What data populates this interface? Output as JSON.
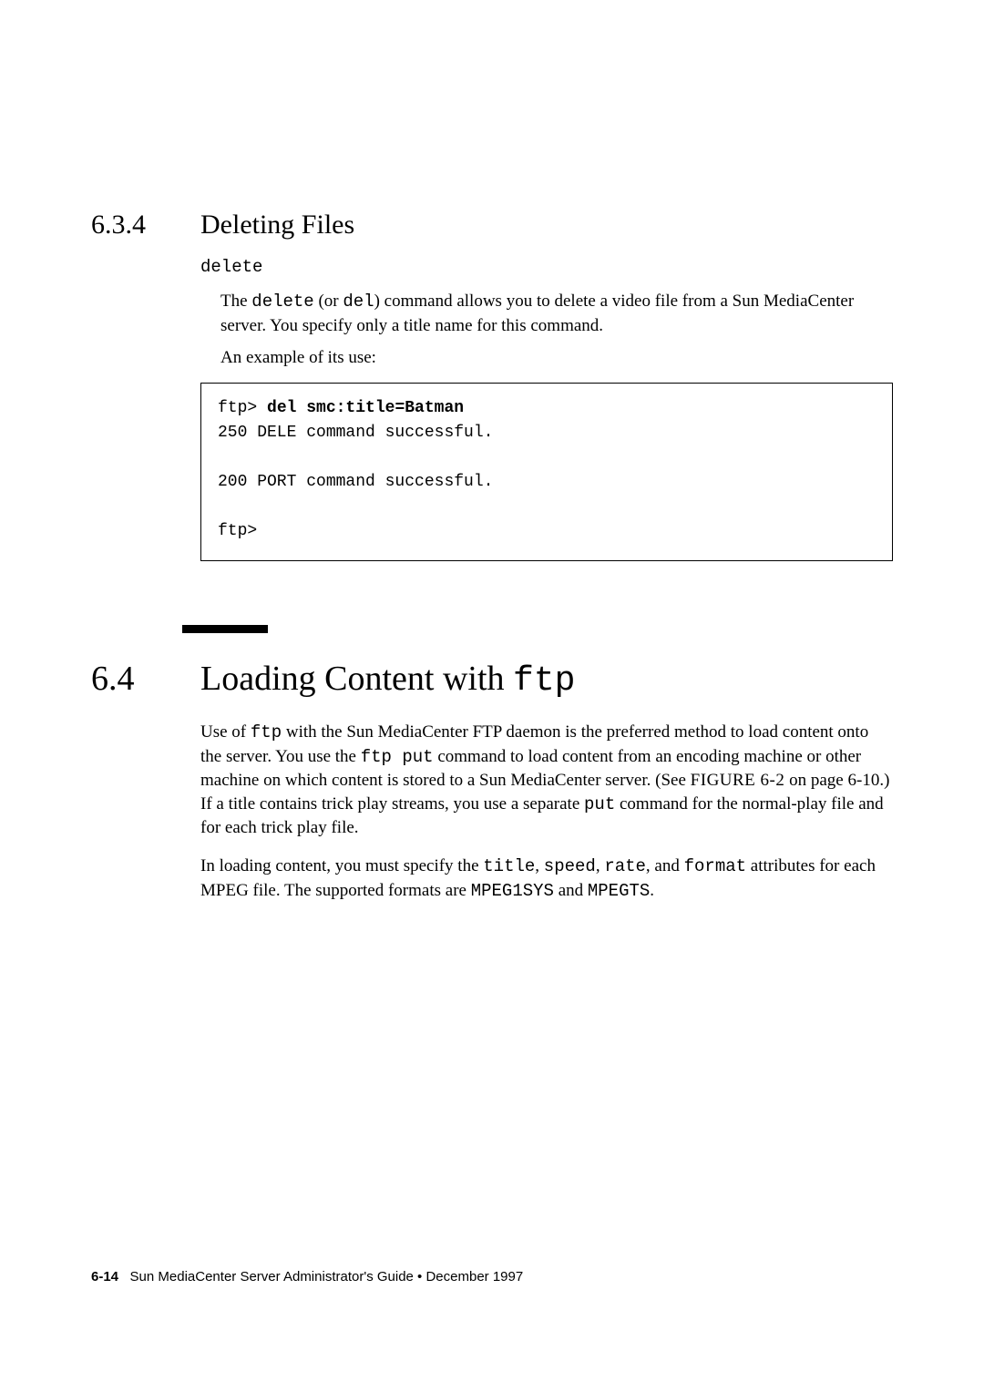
{
  "section_634": {
    "number": "6.3.4",
    "title": "Deleting Files",
    "delete_label": "delete",
    "para1_parts": {
      "a": "The ",
      "b": "delete",
      "c": " (or ",
      "d": "del",
      "e": ") command allows you to delete a video file from a Sun MediaCenter server. You specify only a title name for this command."
    },
    "para2": "An example of its use:",
    "code": {
      "prompt": "ftp> ",
      "cmd": "del smc:title=Batman",
      "line2": "250 DELE command successful.",
      "blank1": "",
      "line3": "200 PORT command successful.",
      "blank2": "",
      "line4": "ftp>"
    }
  },
  "section_64": {
    "number": "6.4",
    "title_a": "Loading Content with ",
    "title_b": "ftp",
    "para1_parts": {
      "a": "Use of ",
      "b": "ftp",
      "c": " with the Sun MediaCenter FTP daemon is the preferred method to load content onto the server. You use the ",
      "d": "ftp put",
      "e": " command to load content from an encoding machine or other machine on which content is stored to a Sun MediaCenter server. (See ",
      "f": "FIGURE 6-2",
      "g": " on page 6-10.) If a title contains trick play streams, you use a separate ",
      "h": "put",
      "i": " command for the normal-play file and for each trick play file."
    },
    "para2_parts": {
      "a": "In loading content, you must specify the ",
      "b": "title",
      "c": ", ",
      "d": "speed",
      "e": ", ",
      "f": "rate",
      "g": ", and ",
      "h": "format",
      "i": " attributes for each MPEG file. The supported formats are ",
      "j": "MPEG1SYS",
      "k": " and ",
      "l": "MPEGTS",
      "m": "."
    }
  },
  "footer": {
    "page_num": "6-14",
    "text": "Sun MediaCenter Server Administrator's Guide • December 1997"
  }
}
